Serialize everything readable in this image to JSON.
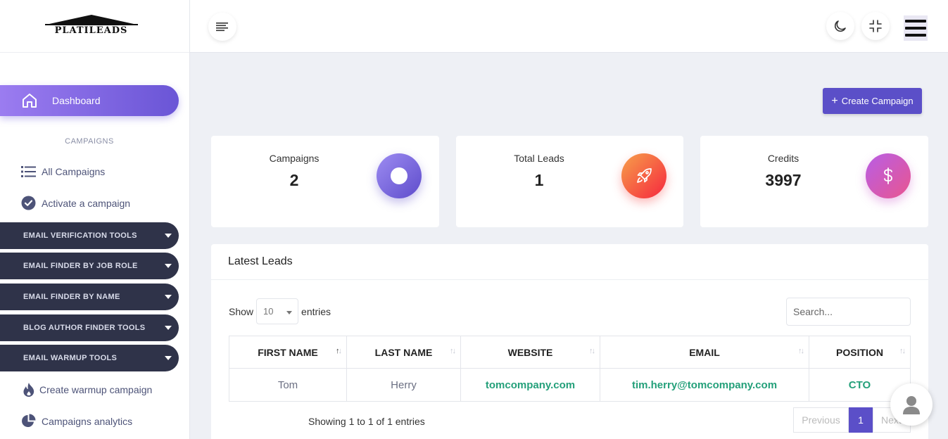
{
  "brand": {
    "name": "PLATILEADS"
  },
  "sidebar": {
    "dashboard_label": "Dashboard",
    "section_label": "CAMPAIGNS",
    "all_campaigns": "All Campaigns",
    "activate_campaign": "Activate a campaign",
    "groups": [
      {
        "label": "EMAIL VERIFICATION TOOLS"
      },
      {
        "label": "EMAIL FINDER BY JOB ROLE"
      },
      {
        "label": "EMAIL FINDER BY NAME"
      },
      {
        "label": "BLOG AUTHOR FINDER TOOLS"
      },
      {
        "label": "EMAIL WARMUP TOOLS"
      }
    ],
    "create_warmup": "Create warmup campaign",
    "analytics": "Campaigns analytics"
  },
  "topbar": {
    "icons": [
      "menu-lines-icon",
      "moon-icon",
      "collapse-icon",
      "hamburger-icon"
    ]
  },
  "actions": {
    "create_campaign": "Create Campaign"
  },
  "stats": [
    {
      "label": "Campaigns",
      "value": "2",
      "color": "#7b68e6"
    },
    {
      "label": "Total Leads",
      "value": "1",
      "color": "#f5463c"
    },
    {
      "label": "Credits",
      "value": "3997",
      "color": "#c75ad9"
    }
  ],
  "leads": {
    "title": "Latest Leads",
    "show_label": "Show",
    "entries_label": "entries",
    "page_length": "10",
    "search_placeholder": "Search...",
    "columns": [
      "FIRST NAME",
      "LAST NAME",
      "WEBSITE",
      "EMAIL",
      "POSITION"
    ],
    "rows": [
      {
        "first_name": "Tom",
        "last_name": "Herry",
        "website": "tomcompany.com",
        "email": "tim.herry@tomcompany.com",
        "position": "CTO"
      }
    ],
    "showing_text": "Showing 1 to 1 of 1 entries",
    "pagination": {
      "previous": "Previous",
      "current": "1",
      "next": "Next"
    }
  },
  "colors": {
    "accent": "#5b4fc8",
    "sidebar_dark": "#2f3349",
    "link_green": "#24a07a"
  }
}
